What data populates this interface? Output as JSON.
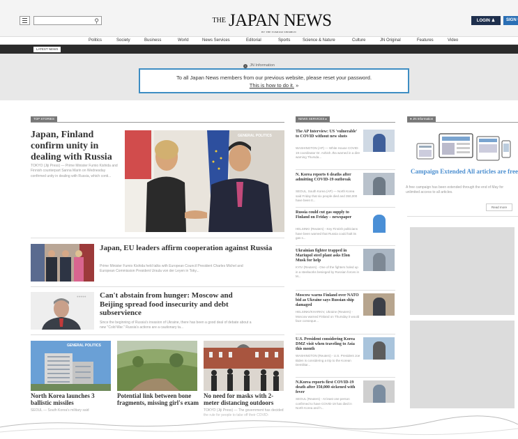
{
  "header": {
    "logo_prefix": "THE",
    "logo_name": "JAPAN NEWS",
    "logo_tagline": "BY THE YOMIURI SHIMBUN",
    "login_label": "LOGIN",
    "signup_label": "SIGN UP",
    "search_icon": "search-icon",
    "menu_icon": "hamburger-menu-icon"
  },
  "nav": {
    "items": [
      "Politics",
      "Society",
      "Business",
      "World",
      "News Services",
      "Editorial",
      "Sports",
      "Science & Nature",
      "Culture",
      "JN Original",
      "Features",
      "Video"
    ]
  },
  "ticker": {
    "label": "LATEST NEWS"
  },
  "notice": {
    "heading": "JN Information",
    "message": "To all Japan News members from our previous website, please reset your password.",
    "link_text": "This is how to do it.",
    "link_arrow": "»"
  },
  "top_stories": {
    "label": "TOP STORIES",
    "lead": {
      "headline": "Japan, Finland confirm unity in dealing with Russia",
      "summary": "TOKYO (Jiji Press) — Prime Minister Fumio Kishida and Finnish counterpart Sanna Marin on Wednesday confirmed unity in dealing with Russia, which conti...",
      "photo_tag": "GENERAL POLITICS"
    },
    "stories": [
      {
        "headline": "Japan, EU leaders affirm cooperation against Russia",
        "summary": "Prime Minister Fumio Kishida held talks with European Council President Charles Michel and European Commission President Ursula von der Leyen in Toky..."
      },
      {
        "headline": "Can't abstain from hunger: Moscow and Beijing spread food insecurity and debt subservience",
        "summary": "Since the beginning of Russia's invasion of Ukraine, there has been a good deal of debate about a new \"Cold War.\" Russia's actions are a cautionary ta..."
      }
    ],
    "bottom": [
      {
        "headline": "North Korea launches 3 ballistic missiles",
        "summary": "SEOUL — South Korea's military said",
        "photo_tag": "GENERAL POLITICS"
      },
      {
        "headline": "Potential link between bone fragments, missing girl's exam",
        "summary": ""
      },
      {
        "headline": "No need for masks with 2-meter distancing outdoors",
        "summary": "TOKYO (Jiji Press) — The government has decided the rule for people to take off their COVID-"
      }
    ]
  },
  "news_services": {
    "label": "NEWS SERVICES",
    "items": [
      {
        "headline": "The AP Interview: US 'vulnerable' to COVID without new shots",
        "summary": "WASHINGTON (AP) — White House COVID-19 coordinator Dr. Ashish Jha warned in a dire warning Thursda..."
      },
      {
        "headline": "N. Korea reports 6 deaths after admitting COVID-19 outbreak",
        "summary": "SEOUL, South Korea (AP) — North Korea said Friday that six people died and 350,000 have been tr..."
      },
      {
        "headline": "Russia could cut gas supply to Finland on Friday – newspaper",
        "summary": "HELSINKI (Reuters) - Key Finnish politicians have been warned that Russia could halt its gas s..."
      },
      {
        "headline": "Ukrainian fighter trapped in Mariupol steel plant asks Elon Musk for help",
        "summary": "KYIV (Reuters) - One of the fighters holed up in a steelworks besieged by Russian forces in M..."
      },
      {
        "headline": "Moscow warns Finland over NATO bid as Ukraine says Russian ship damaged",
        "summary": "HELSINKI/KHARKIV, Ukraine (Reuters) - Moscow warned Finland on Thursday it would face conseque..."
      },
      {
        "headline": "U.S. President considering Korea DMZ visit when traveling to Asia this month",
        "summary": "WASHINGTON (Reuters) - U.S. President Joe Biden is considering a trip to the Korean Demilitar..."
      },
      {
        "headline": "N.Korea reports first COVID-19 death after 350,000 sickened with fever",
        "summary": "SEOUL (Reuters) - At least one person confirmed to have COVID-19 has died in North Korea and h..."
      }
    ]
  },
  "jn_information": {
    "label": "JN Information",
    "campaign_title": "Campaign Extended All articles are free",
    "campaign_text": "A free campaign has been extended through the end of May for unlimited access to all articles.",
    "read_more": "Read more"
  },
  "colors": {
    "login_bg": "#1e2f4d",
    "signup_bg": "#2a6fb5",
    "notice_border": "#3d8dc3",
    "campaign_title": "#4c8fd0"
  }
}
